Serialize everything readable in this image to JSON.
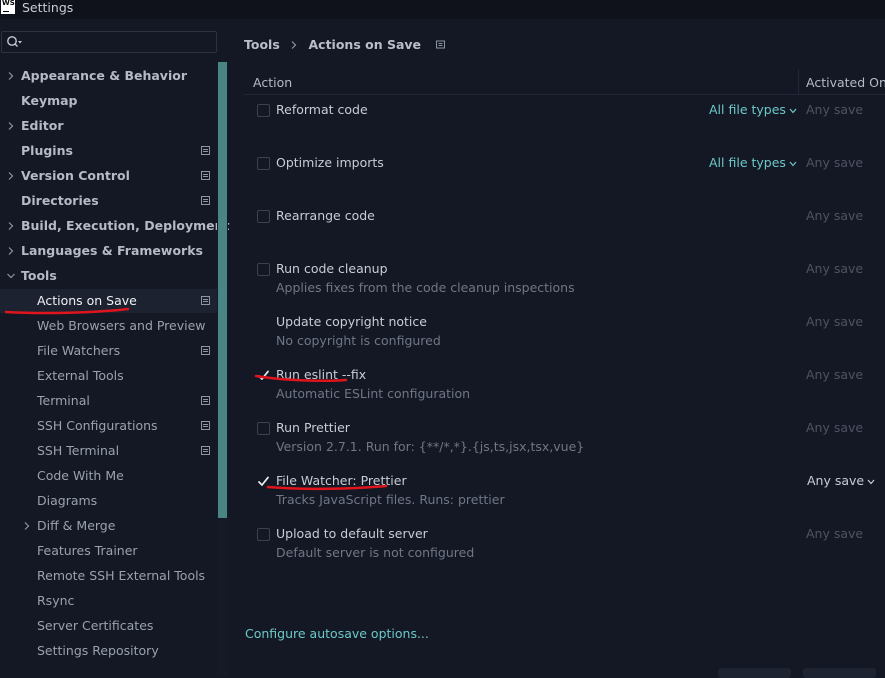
{
  "window": {
    "logo_text_1": "WS",
    "logo_text_2": "",
    "title": "Settings"
  },
  "search": {
    "placeholder": "",
    "value": ""
  },
  "sidebar": {
    "items": [
      {
        "label": "Appearance & Behavior",
        "level": 0,
        "has_chevron": true,
        "settings_icon": false
      },
      {
        "label": "Keymap",
        "level": 0,
        "has_chevron": false,
        "settings_icon": false
      },
      {
        "label": "Editor",
        "level": 0,
        "has_chevron": true,
        "settings_icon": false
      },
      {
        "label": "Plugins",
        "level": 0,
        "has_chevron": false,
        "settings_icon": true
      },
      {
        "label": "Version Control",
        "level": 0,
        "has_chevron": true,
        "settings_icon": true
      },
      {
        "label": "Directories",
        "level": 0,
        "has_chevron": false,
        "settings_icon": true
      },
      {
        "label": "Build, Execution, Deployment",
        "level": 0,
        "has_chevron": true,
        "settings_icon": false
      },
      {
        "label": "Languages & Frameworks",
        "level": 0,
        "has_chevron": true,
        "settings_icon": false
      },
      {
        "label": "Tools",
        "level": 0,
        "has_chevron": true,
        "expanded": true,
        "settings_icon": false
      },
      {
        "label": "Actions on Save",
        "level": 1,
        "has_chevron": false,
        "settings_icon": true,
        "selected": true
      },
      {
        "label": "Web Browsers and Preview",
        "level": 1,
        "has_chevron": false,
        "settings_icon": false
      },
      {
        "label": "File Watchers",
        "level": 1,
        "has_chevron": false,
        "settings_icon": true
      },
      {
        "label": "External Tools",
        "level": 1,
        "has_chevron": false,
        "settings_icon": false
      },
      {
        "label": "Terminal",
        "level": 1,
        "has_chevron": false,
        "settings_icon": true
      },
      {
        "label": "SSH Configurations",
        "level": 1,
        "has_chevron": false,
        "settings_icon": true
      },
      {
        "label": "SSH Terminal",
        "level": 1,
        "has_chevron": false,
        "settings_icon": true
      },
      {
        "label": "Code With Me",
        "level": 1,
        "has_chevron": false,
        "settings_icon": false
      },
      {
        "label": "Diagrams",
        "level": 1,
        "has_chevron": false,
        "settings_icon": false
      },
      {
        "label": "Diff & Merge",
        "level": 1,
        "has_chevron": true,
        "settings_icon": false
      },
      {
        "label": "Features Trainer",
        "level": 1,
        "has_chevron": false,
        "settings_icon": false
      },
      {
        "label": "Remote SSH External Tools",
        "level": 1,
        "has_chevron": false,
        "settings_icon": false
      },
      {
        "label": "Rsync",
        "level": 1,
        "has_chevron": false,
        "settings_icon": false
      },
      {
        "label": "Server Certificates",
        "level": 1,
        "has_chevron": false,
        "settings_icon": false
      },
      {
        "label": "Settings Repository",
        "level": 1,
        "has_chevron": false,
        "settings_icon": false
      }
    ]
  },
  "breadcrumb": {
    "parent": "Tools",
    "current": "Actions on Save"
  },
  "table": {
    "header_action": "Action",
    "header_activated": "Activated On",
    "rows": [
      {
        "title": "Reformat code",
        "subtitle": "",
        "checkbox": "unchecked",
        "file_types": "All file types",
        "activated": "Any save",
        "activated_enabled": false
      },
      {
        "title": "Optimize imports",
        "subtitle": "",
        "checkbox": "unchecked",
        "file_types": "All file types",
        "activated": "Any save",
        "activated_enabled": false
      },
      {
        "title": "Rearrange code",
        "subtitle": "",
        "checkbox": "unchecked",
        "file_types": "",
        "activated": "Any save",
        "activated_enabled": false
      },
      {
        "title": "Run code cleanup",
        "subtitle": "Applies fixes from the code cleanup inspections",
        "checkbox": "unchecked",
        "file_types": "",
        "activated": "Any save",
        "activated_enabled": false
      },
      {
        "title": "Update copyright notice",
        "subtitle": "No copyright is configured",
        "checkbox": "none",
        "file_types": "",
        "activated": "Any save",
        "activated_enabled": false
      },
      {
        "title": "Run eslint --fix",
        "subtitle": "Automatic ESLint configuration",
        "checkbox": "checked",
        "file_types": "",
        "activated": "Any save",
        "activated_enabled": false,
        "underlined": true
      },
      {
        "title": "Run Prettier",
        "subtitle": "Version 2.7.1. Run for: {**/*,*}.{js,ts,jsx,tsx,vue}",
        "checkbox": "unchecked",
        "file_types": "",
        "activated": "Any save",
        "activated_enabled": false
      },
      {
        "title": "File Watcher: Prettier",
        "subtitle": "Tracks JavaScript files. Runs: prettier",
        "checkbox": "checked",
        "file_types": "",
        "activated": "Any save",
        "activated_enabled": true,
        "underlined": true
      },
      {
        "title": "Upload to default server",
        "subtitle": "Default server is not configured",
        "checkbox": "unchecked",
        "file_types": "",
        "activated": "Any save",
        "activated_enabled": false
      }
    ]
  },
  "footer": {
    "configure_link": "Configure autosave options..."
  },
  "colors": {
    "background": "#141824",
    "accent_link": "#6ac9c9",
    "scrollbar": "#4a8585",
    "annotation_underline": "#e0141c",
    "check": "#e8eaee"
  },
  "annotations": {
    "red_underlines": [
      "Actions on Save",
      "Run eslint --fix",
      "File Watcher: Prettier"
    ]
  }
}
